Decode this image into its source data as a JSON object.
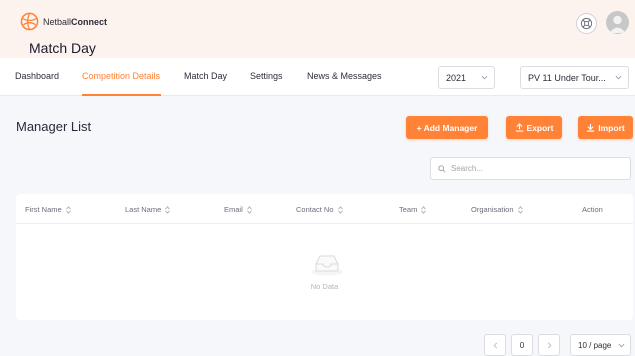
{
  "app": {
    "brand_prefix": "Netball",
    "brand_suffix": "Connect",
    "page_title": "Match Day"
  },
  "nav": {
    "items": [
      "Dashboard",
      "Competition Details",
      "Match Day",
      "Settings",
      "News & Messages"
    ],
    "active_index": 1,
    "year_select": "2021",
    "competition_select": "PV 11 Under Tour..."
  },
  "main": {
    "title": "Manager List",
    "buttons": {
      "add": "+ Add Manager",
      "export": "Export",
      "import": "Import"
    },
    "search_placeholder": "Search..."
  },
  "table": {
    "columns": [
      "First Name",
      "Last Name",
      "Email",
      "Contact No",
      "Team",
      "Organisation",
      "Action"
    ],
    "empty_text": "No Data"
  },
  "pagination": {
    "current_page": "0",
    "page_size": "10 / page"
  },
  "colors": {
    "accent": "#ff8237",
    "header_bg": "#fdf3ee",
    "content_bg": "#f5f7fb"
  }
}
